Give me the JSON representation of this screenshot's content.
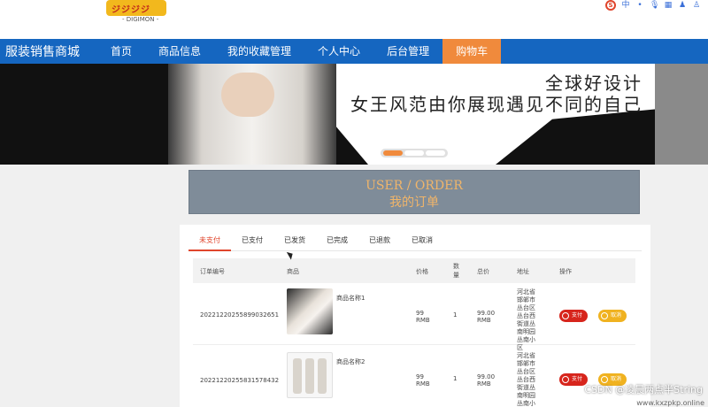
{
  "logo": {
    "text": "ジジジジ",
    "sub": "- DIGIMON -"
  },
  "toolbar": {
    "s_label": "S",
    "items": [
      "中",
      "•",
      "🎙",
      "▦",
      "♟",
      "♙"
    ]
  },
  "navbar": {
    "brand": "服装销售商城",
    "items": [
      "首页",
      "商品信息",
      "我的收藏管理",
      "个人中心",
      "后台管理",
      "购物车"
    ]
  },
  "banner": {
    "line1": "全球好设计",
    "line2": "女王风范由你展现遇见不同的自己"
  },
  "order_header": {
    "en": "USER / ORDER",
    "cn": "我的订单"
  },
  "tabs": [
    "未支付",
    "已支付",
    "已发货",
    "已完成",
    "已退款",
    "已取消"
  ],
  "table": {
    "headers": [
      "订单编号",
      "商品",
      "价格",
      "数量",
      "总价",
      "地址",
      "操作"
    ],
    "rows": [
      {
        "id": "20221220255899032651",
        "name": "商品名称1",
        "price": "99 RMB",
        "qty": "1",
        "total": "99.00 RMB",
        "address": "河北省邯郸市丛台区丛台西街道丛南明园丛南小区",
        "pay": "支付",
        "cancel": "取消"
      },
      {
        "id": "20221220255831578432",
        "name": "商品名称2",
        "price": "99 RMB",
        "qty": "1",
        "total": "99.00 RMB",
        "address": "河北省邯郸市丛台区丛台西街道丛南明园丛南小区",
        "pay": "支付",
        "cancel": "取消"
      }
    ]
  },
  "watermark": "CSDN @凌晨两点半String",
  "watermark2": "www.kxzpkp.online"
}
